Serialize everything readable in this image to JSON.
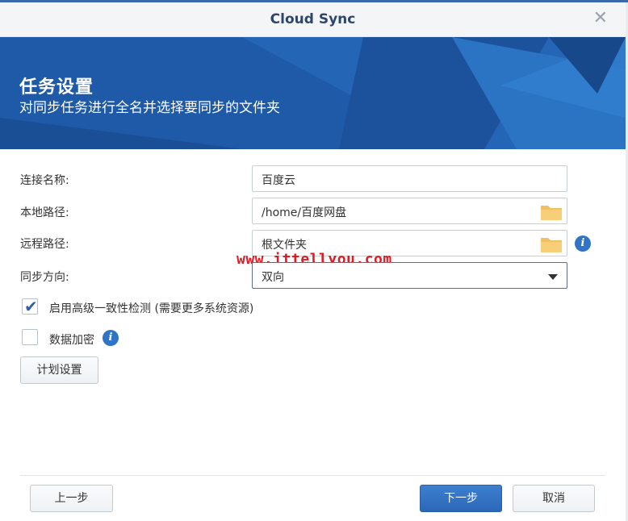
{
  "window": {
    "title": "Cloud Sync",
    "close_glyph": "✕"
  },
  "banner": {
    "title": "任务设置",
    "subtitle": "对同步任务进行全名并选择要同步的文件夹"
  },
  "form": {
    "connection_name": {
      "label": "连接名称:",
      "value": "百度云"
    },
    "local_path": {
      "label": "本地路径:",
      "value": "/home/百度网盘",
      "icon": "folder-icon"
    },
    "remote_path": {
      "label": "远程路径:",
      "value": "根文件夹",
      "icon": "folder-icon",
      "info_icon": "info-icon"
    },
    "sync_direction": {
      "label": "同步方向:",
      "value": "双向"
    },
    "watermark": "www.ittellyou.com",
    "advanced_check": {
      "label": "启用高级一致性检测 (需要更多系统资源)",
      "checked": true
    },
    "encryption": {
      "label": "数据加密",
      "checked": false,
      "info_icon": "info-icon"
    },
    "schedule_button": "计划设置"
  },
  "footer": {
    "prev_button": "上一步",
    "next_button": "下一步",
    "cancel_button": "取消"
  },
  "colors": {
    "banner": "#1e5aa8",
    "primary_button": "#2c67b7",
    "info_icon": "#2f74c5",
    "folder_icon": "#f2c063",
    "watermark": "#e21b22"
  }
}
